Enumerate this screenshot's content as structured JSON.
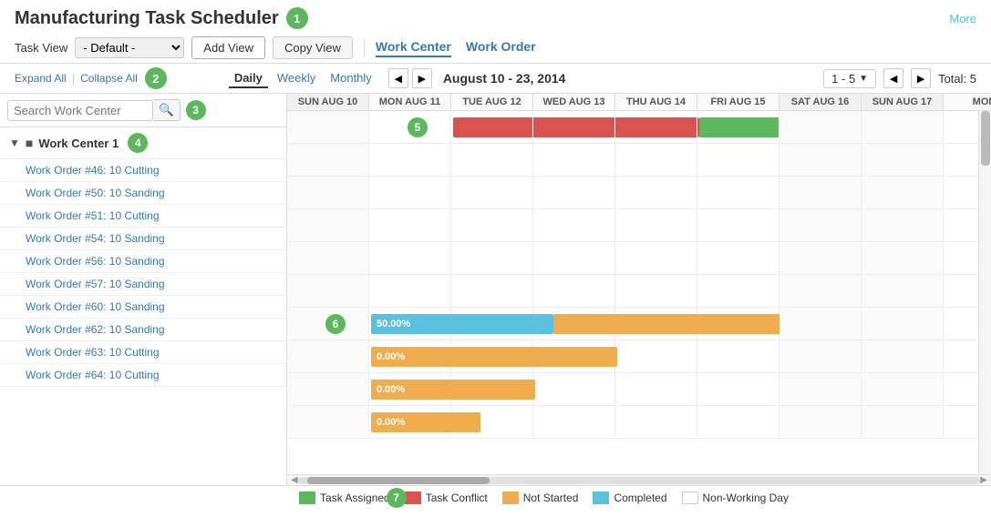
{
  "app": {
    "title": "Manufacturing Task Scheduler",
    "more_link": "More"
  },
  "badges": {
    "title_badge": "1",
    "controls_badge": "2",
    "search_badge": "3",
    "workcenter_badge": "4",
    "gantt_badge5": "5",
    "gantt_badge6": "6",
    "legend_badge": "7"
  },
  "task_view": {
    "label": "Task View",
    "default_value": "- Default -",
    "add_view_label": "Add View",
    "copy_view_label": "Copy View"
  },
  "nav_links": [
    {
      "label": "Work Center",
      "active": true
    },
    {
      "label": "Work Order",
      "active": false
    }
  ],
  "controls": {
    "expand_all": "Expand All",
    "collapse_all": "Collapse All"
  },
  "period_tabs": [
    {
      "label": "Daily",
      "active": true
    },
    {
      "label": "Weekly",
      "active": false
    },
    {
      "label": "Monthly",
      "active": false
    }
  ],
  "date_range": "August 10 - 23, 2014",
  "page_indicator": "1 - 5",
  "total": "Total: 5",
  "search": {
    "placeholder": "Search Work Center"
  },
  "work_center": {
    "name": "Work Center 1",
    "tasks": [
      "Work Order #46: 10 Cutting",
      "Work Order #50: 10 Sanding",
      "Work Order #51: 10 Cutting",
      "Work Order #54: 10 Sanding",
      "Work Order #56: 10 Sanding",
      "Work Order #57: 10 Sanding",
      "Work Order #60: 10 Sanding",
      "Work Order #62: 10 Sanding",
      "Work Order #63: 10 Cutting",
      "Work Order #64: 10 Cutting"
    ]
  },
  "gantt_columns": [
    {
      "label": "SUN AUG 10",
      "weekend": true
    },
    {
      "label": "MON AUG 11",
      "weekend": false
    },
    {
      "label": "TUE AUG 12",
      "weekend": false
    },
    {
      "label": "WED AUG 13",
      "weekend": false
    },
    {
      "label": "THU AUG 14",
      "weekend": false
    },
    {
      "label": "FRI AUG 15",
      "weekend": false
    },
    {
      "label": "SAT AUG 16",
      "weekend": true
    },
    {
      "label": "SUN AUG 17",
      "weekend": true
    },
    {
      "label": "MON",
      "weekend": false
    }
  ],
  "legend": [
    {
      "label": "Task Assigned",
      "color": "green"
    },
    {
      "label": "Task Conflict",
      "color": "red"
    },
    {
      "label": "Not Started",
      "color": "yellow"
    },
    {
      "label": "Completed",
      "color": "blue"
    },
    {
      "label": "Non-Working Day",
      "color": "white"
    }
  ]
}
